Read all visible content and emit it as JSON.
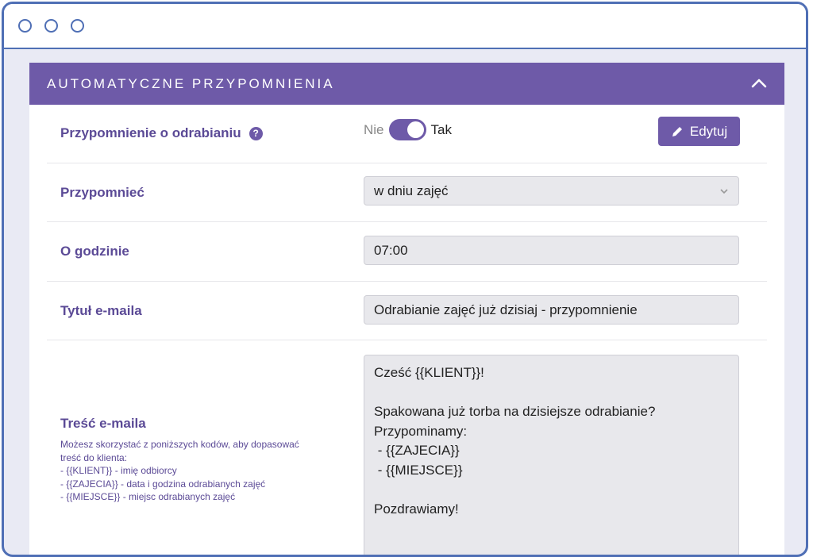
{
  "panel": {
    "title": "AUTOMATYCZNE PRZYPOMNIENIA"
  },
  "reminder": {
    "label": "Przypomnienie o odrabianiu",
    "help": "?",
    "toggle_off": "Nie",
    "toggle_on": "Tak",
    "toggle_state": "on",
    "edit_label": "Edytuj"
  },
  "remind": {
    "label": "Przypomnieć",
    "value": "w dniu zajęć"
  },
  "hour": {
    "label": "O godzinie",
    "value": "07:00"
  },
  "subject": {
    "label": "Tytuł e-maila",
    "value": "Odrabianie zajęć już dzisiaj - przypomnienie"
  },
  "body": {
    "label": "Treść e-maila",
    "help_lines": [
      "Możesz skorzystać z poniższych kodów, aby dopasować",
      "treść do klienta:",
      "- {{KLIENT}} - imię odbiorcy",
      "- {{ZAJECIA}} - data i godzina odrabianych zajęć",
      "- {{MIEJSCE}} - miejsc odrabianych zajęć"
    ],
    "content_lines": [
      "Cześć {{KLIENT}}!",
      "",
      "Spakowana już torba na dzisiejsze odrabianie?",
      "Przypominamy:",
      " - {{ZAJECIA}}",
      " - {{MIEJSCE}}",
      "",
      "Pozdrawiamy!"
    ]
  },
  "colors": {
    "accent": "#6e5aa8",
    "frame": "#4f6fb5"
  }
}
